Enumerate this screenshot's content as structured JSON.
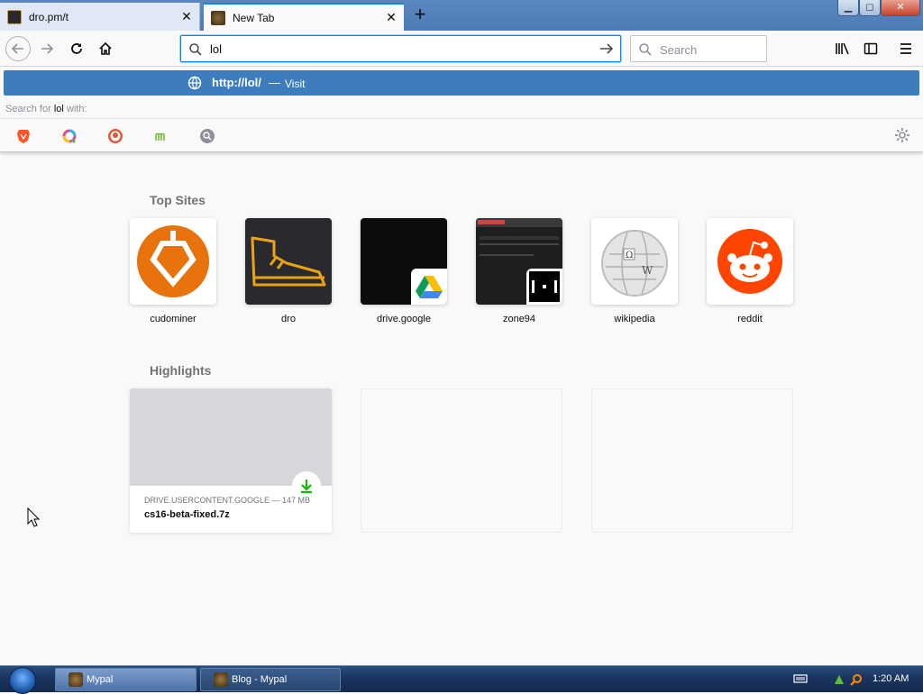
{
  "tabs": [
    {
      "label": "dro.pm/t",
      "active": false
    },
    {
      "label": "New Tab",
      "active": true
    }
  ],
  "window_controls": {
    "minimize": "▁",
    "maximize": "◻",
    "close": "✕"
  },
  "nav": {
    "back_icon": "arrow-left-icon",
    "forward_icon": "arrow-right-icon",
    "reload_icon": "reload-icon",
    "home_icon": "home-icon"
  },
  "urlbar": {
    "value": "lol"
  },
  "searchbox": {
    "placeholder": "Search"
  },
  "toolbar_right": [
    "library-icon",
    "sidebar-icon",
    "menu-icon"
  ],
  "dropdown": {
    "suggestion_url": "http://lol/",
    "suggestion_sep": "—",
    "suggestion_action": "Visit",
    "search_with_prefix": "Search for",
    "search_with_query": "lol",
    "search_with_suffix": "with:",
    "engines": [
      "brave-icon",
      "qwant-icon",
      "duckduckgo-icon",
      "mojeek-icon",
      "search-engine-icon"
    ]
  },
  "top_sites": {
    "title": "Top Sites",
    "items": [
      {
        "label": "cudominer"
      },
      {
        "label": "dro"
      },
      {
        "label": "drive.google"
      },
      {
        "label": "zone94"
      },
      {
        "label": "wikipedia"
      },
      {
        "label": "reddit"
      }
    ]
  },
  "highlights": {
    "title": "Highlights",
    "card": {
      "meta": "DRIVE.USERCONTENT.GOOGLE — 147 MB",
      "title": "cs16-beta-fixed.7z"
    }
  },
  "taskbar": {
    "items": [
      {
        "label": "Mypal",
        "active": true
      },
      {
        "label": "Blog - Mypal",
        "active": false
      }
    ],
    "clock": "1:20 AM"
  },
  "colors": {
    "accent": "#0a84ff",
    "suggestion_bg": "#3e7dbd",
    "reddit": "#ff4500",
    "cudominer": "#e8720c"
  }
}
